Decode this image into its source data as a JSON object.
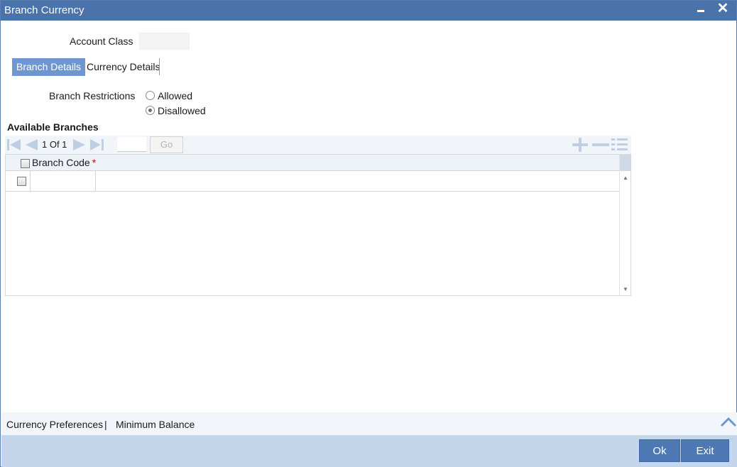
{
  "window": {
    "title": "Branch Currency"
  },
  "header": {
    "account_class_label": "Account Class",
    "account_class_value": ""
  },
  "tabs": [
    {
      "label": "Branch Details",
      "active": true
    },
    {
      "label": "Currency Details",
      "active": false
    }
  ],
  "branch_restrictions": {
    "label": "Branch Restrictions",
    "options": [
      {
        "label": "Allowed",
        "selected": false
      },
      {
        "label": "Disallowed",
        "selected": true
      }
    ]
  },
  "available_branches": {
    "title": "Available Branches",
    "pagination": {
      "text": "1  Of  1",
      "page_input": "",
      "go_label": "Go"
    },
    "columns": [
      {
        "label": "Branch Code",
        "required_marker": "*"
      }
    ],
    "rows": [
      {
        "branch_code": ""
      }
    ]
  },
  "footer": {
    "links": [
      "Currency Preferences",
      "Minimum Balance"
    ],
    "separator": "|"
  },
  "buttons": {
    "ok": "Ok",
    "exit": "Exit"
  },
  "colors": {
    "titlebar": "#4a72ab",
    "active_tab": "#6f97cf",
    "button": "#4d78b4",
    "bottom_bar": "#c3d6ec",
    "required": "#cc0000"
  },
  "icons": [
    "minimize-icon",
    "close-icon",
    "first-page-icon",
    "previous-page-icon",
    "next-page-icon",
    "last-page-icon",
    "add-row-icon",
    "delete-row-icon",
    "single-view-icon",
    "collapse-up-icon"
  ]
}
